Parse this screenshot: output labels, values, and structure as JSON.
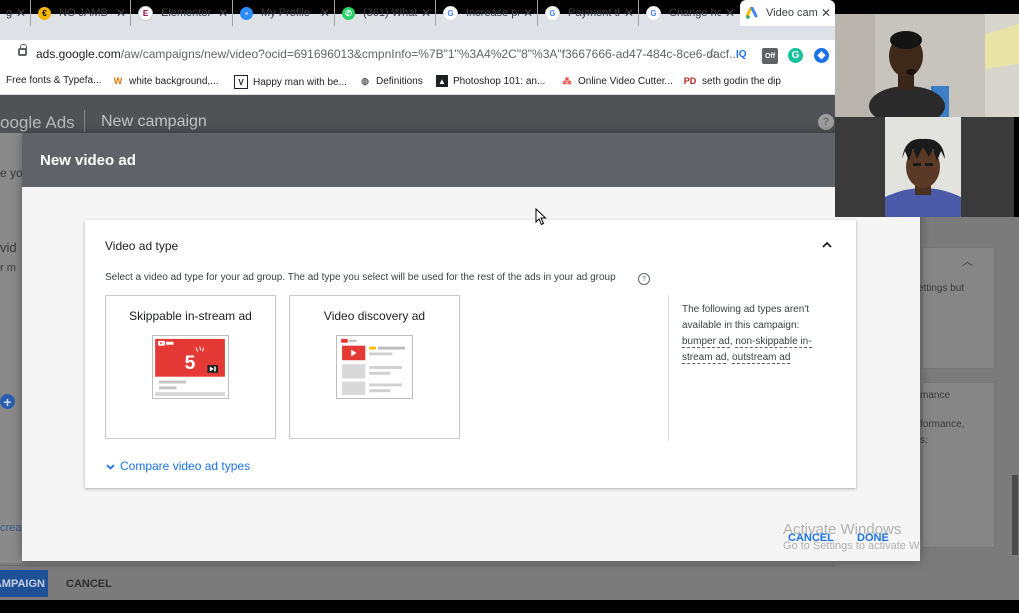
{
  "browser": {
    "tabs": [
      {
        "title": "g",
        "icon": "globe-icon",
        "color": "#5f6368"
      },
      {
        "title": "NO JAMB R",
        "icon": "jamb-icon",
        "color": "#f4b400"
      },
      {
        "title": "Elementor |",
        "icon": "elementor-icon",
        "color": "#92003b"
      },
      {
        "title": "My Profile",
        "icon": "zoom-icon",
        "color": "#2d8cff"
      },
      {
        "title": "(361) What",
        "icon": "whatsapp-icon",
        "color": "#25d366"
      },
      {
        "title": "Increase pa",
        "icon": "google-icon",
        "color": "#4285f4"
      },
      {
        "title": "Payment th",
        "icon": "google-icon",
        "color": "#4285f4"
      },
      {
        "title": "Change ho",
        "icon": "google-icon",
        "color": "#4285f4"
      },
      {
        "title": "Video camp",
        "icon": "google-ads-icon",
        "color": "#fbbc04"
      }
    ],
    "url_host": "ads.google.com",
    "url_path": "/aw/campaigns/new/video?ocid=691696013&cmpnInfo=%7B\"1\"%3A4%2C\"8\"%3A\"f3667666-ad47-484c-8ce6-dacf...",
    "bookmarks": [
      {
        "label": "Free fonts & Typefa...",
        "icon": ""
      },
      {
        "label": "white background,...",
        "icon": "W"
      },
      {
        "label": "Happy man with be...",
        "icon": "V"
      },
      {
        "label": "Definitions",
        "icon": ""
      },
      {
        "label": "Photoshop 101: an...",
        "icon": ""
      },
      {
        "label": "Online Video Cutter...",
        "icon": ""
      },
      {
        "label": "seth godin the dip",
        "icon": "PD"
      }
    ],
    "ext_iq": "IQ",
    "ext_off": "Off"
  },
  "app": {
    "logo": "oogle Ads",
    "title": "New campaign",
    "bg_text1": "e yo",
    "bg_text2": "vid",
    "bg_text3": "r m",
    "bg_text4": "creat",
    "footer_campaign": "AMPAIGN",
    "footer_cancel": "CANCEL",
    "right_text1": "ettings but",
    "right_text2": "mance",
    "right_text3": "formance,",
    "right_text4": "s:"
  },
  "dialog": {
    "title": "New video ad",
    "section_title": "Video ad type",
    "description": "Select a video ad type for your ad group. The ad type you select will be used for the rest of the ads in your ad group",
    "options": [
      {
        "label": "Skippable in-stream ad",
        "countdown": "5"
      },
      {
        "label": "Video discovery ad"
      }
    ],
    "not_available_intro": "The following ad types aren't available in this campaign:",
    "not_available_types": [
      "bumper ad",
      "non-skippable in-stream ad",
      "outstream ad"
    ],
    "compare_link": "Compare video ad types",
    "cancel_label": "CANCEL",
    "done_label": "DONE"
  },
  "watermark": {
    "line1": "Activate Windows",
    "line2": "Go to Settings to activate Wi"
  },
  "colors": {
    "accent": "#1a73e8",
    "youtube_red": "#ff0000"
  }
}
